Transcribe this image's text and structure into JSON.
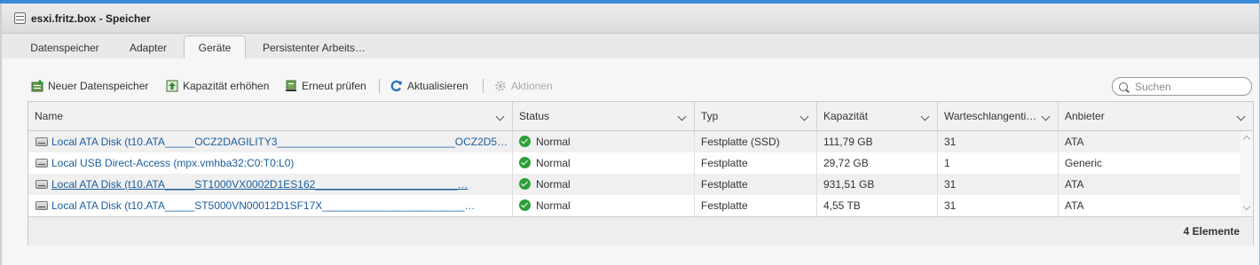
{
  "window": {
    "title": "esxi.fritz.box - Speicher"
  },
  "tabs": [
    {
      "label": "Datenspeicher"
    },
    {
      "label": "Adapter"
    },
    {
      "label": "Geräte",
      "active": true
    },
    {
      "label": "Persistenter Arbeits…"
    }
  ],
  "toolbar": {
    "new_datastore": "Neuer Datenspeicher",
    "increase_capacity": "Kapazität erhöhen",
    "rescan": "Erneut prüfen",
    "refresh": "Aktualisieren",
    "actions": "Aktionen",
    "search_placeholder": "Suchen"
  },
  "table": {
    "columns": [
      "Name",
      "Status",
      "Typ",
      "Kapazität",
      "Warteschlangenti…",
      "Anbieter"
    ],
    "rows": [
      {
        "name": "Local ATA Disk (t10.ATA_____OCZ2DAGILITY3______________________________OCZ2D5…",
        "status": "Normal",
        "type": "Festplatte (SSD)",
        "capacity": "111,79 GB",
        "queue": "31",
        "vendor": "ATA"
      },
      {
        "name": "Local USB Direct-Access (mpx.vmhba32:C0:T0:L0)",
        "status": "Normal",
        "type": "Festplatte",
        "capacity": "29,72 GB",
        "queue": "1",
        "vendor": "Generic"
      },
      {
        "name": "Local ATA Disk (t10.ATA_____ST1000VX0002D1ES162________________________…",
        "status": "Normal",
        "type": "Festplatte",
        "capacity": "931,51 GB",
        "queue": "31",
        "vendor": "ATA"
      },
      {
        "name": "Local ATA Disk (t10.ATA_____ST5000VN00012D1SF17X________________________…",
        "status": "Normal",
        "type": "Festplatte",
        "capacity": "4,55 TB",
        "queue": "31",
        "vendor": "ATA"
      }
    ],
    "footer_count": "4 Elemente"
  },
  "colors": {
    "accent": "#3b8ad8",
    "link": "#1a5d9e",
    "ok": "#2e9e3a"
  }
}
